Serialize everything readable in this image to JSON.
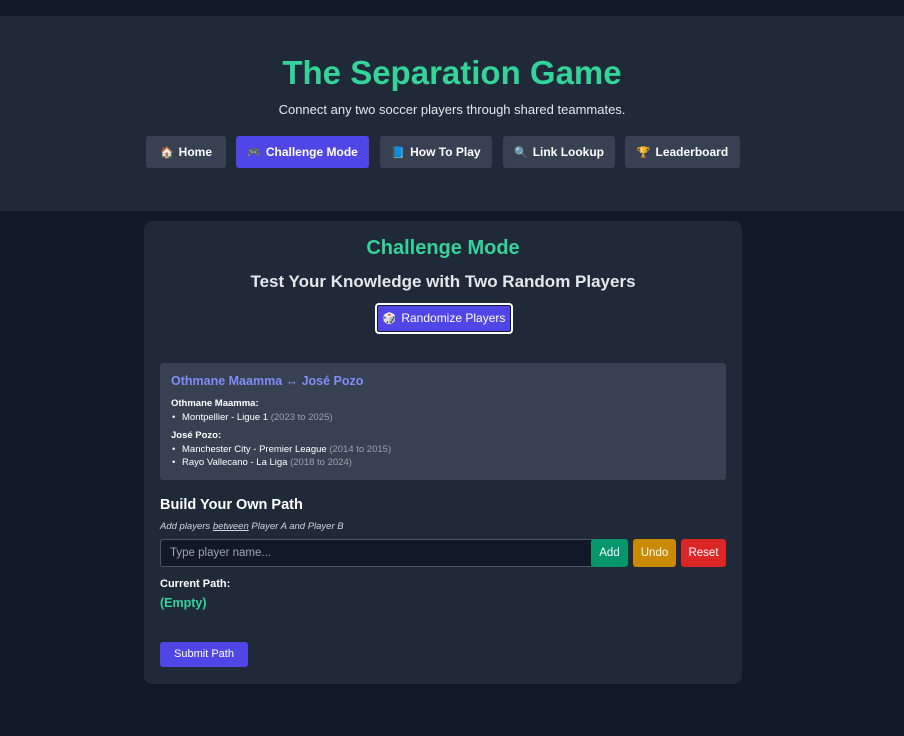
{
  "header": {
    "title": "The Separation Game",
    "subtitle": "Connect any two soccer players through shared teammates."
  },
  "nav": [
    {
      "icon": "🏠",
      "icon_name": "home-icon",
      "label": "Home",
      "active": false
    },
    {
      "icon": "🎮",
      "icon_name": "game-controller-icon",
      "label": "Challenge Mode",
      "active": true
    },
    {
      "icon": "📘",
      "icon_name": "book-icon",
      "label": "How To Play",
      "active": false
    },
    {
      "icon": "🔍",
      "icon_name": "magnifier-icon",
      "label": "Link Lookup",
      "active": false
    },
    {
      "icon": "🏆",
      "icon_name": "trophy-icon",
      "label": "Leaderboard",
      "active": false
    }
  ],
  "challenge": {
    "title": "Challenge Mode",
    "subtitle": "Test Your Knowledge with Two Random Players",
    "randomize": {
      "icon": "🎲",
      "icon_name": "dice-icon",
      "label": "Randomize Players"
    }
  },
  "players": {
    "pair_title": "Othmane Maamma ↔ José Pozo",
    "player_a": {
      "name": "Othmane Maamma:",
      "clubs": [
        {
          "club": "Montpellier - Ligue 1",
          "years": "(2023 to 2025)"
        }
      ]
    },
    "player_b": {
      "name": "José Pozo:",
      "clubs": [
        {
          "club": "Manchester City - Premier League",
          "years": "(2014 to 2015)"
        },
        {
          "club": "Rayo Vallecano - La Liga",
          "years": "(2018 to 2024)"
        }
      ]
    }
  },
  "build": {
    "title": "Build Your Own Path",
    "hint_prefix": "Add players ",
    "hint_emph": "between",
    "hint_suffix": " Player A and Player B",
    "input_placeholder": "Type player name...",
    "input_value": "",
    "add_label": "Add",
    "undo_label": "Undo",
    "reset_label": "Reset",
    "current_path_label": "Current Path:",
    "current_path_value": "(Empty)",
    "submit_label": "Submit Path"
  },
  "colors": {
    "accent_green": "#34d399",
    "accent_indigo": "#4f46e5",
    "link_indigo": "#818cf8",
    "add_green": "#059669",
    "undo_yellow": "#ca8a04",
    "reset_red": "#dc2626"
  }
}
